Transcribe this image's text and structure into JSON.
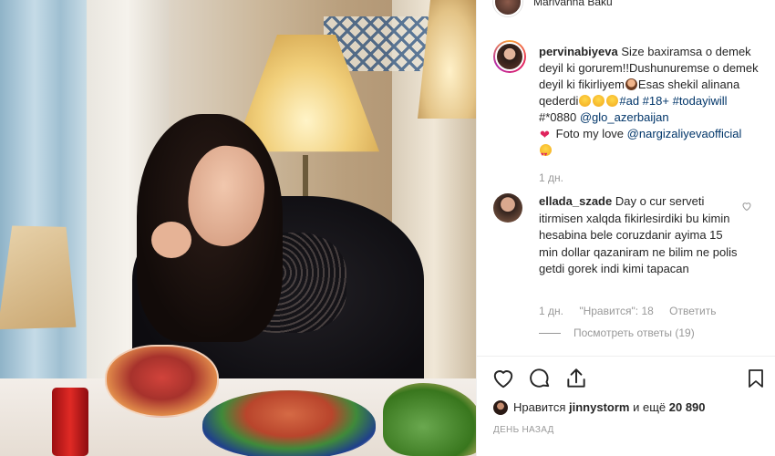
{
  "header": {
    "location": "Marivanna Baku"
  },
  "post": {
    "username": "pervinabiyeva",
    "caption_part1": "Size baxiramsa o demek deyil ki gorurem!!Dushunuremse o demek deyil ki fikirliyem",
    "caption_part2": "Esas shekil alinana qederdi",
    "hashtags": "#ad #18+",
    "hashtag2": "#todayiwill",
    "hashtag3_prefix": "#*0880",
    "mention1": "@glo_azerbaijan",
    "foto_text": "Foto my love",
    "mention2": "@nargizaliyevaofficial",
    "time": "1 дн."
  },
  "comment": {
    "username": "ellada_szade",
    "text": "Day o cur serveti itirmisen xalqda fikirlesirdiki bu kimin hesabina bele coruzdanir ayima 15 min dollar qazaniram ne bilim ne polis getdi gorek indi kimi tapacan",
    "time": "1 дн.",
    "likes_label": "\"Нравится\": 18",
    "reply_label": "Ответить",
    "view_replies": "Посмотреть ответы (19)"
  },
  "actions": {
    "like_icon": "heart-outline-icon",
    "comment_icon": "comment-bubble-icon",
    "share_icon": "share-icon",
    "save_icon": "bookmark-icon"
  },
  "likes": {
    "prefix": "Нравится",
    "user": "jinnystorm",
    "and_more": "и ещё",
    "count": "20 890"
  },
  "posted_ago": "ДЕНЬ НАЗАД",
  "colors": {
    "link": "#003569",
    "meta_text": "#999999",
    "text": "#262626",
    "border": "#efefef"
  }
}
